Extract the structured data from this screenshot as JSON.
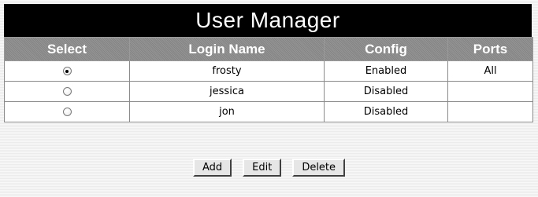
{
  "title": "User Manager",
  "columns": {
    "select": "Select",
    "login": "Login Name",
    "config": "Config",
    "ports": "Ports"
  },
  "rows": [
    {
      "selected": true,
      "login": "frosty",
      "config": "Enabled",
      "ports": "All"
    },
    {
      "selected": false,
      "login": "jessica",
      "config": "Disabled",
      "ports": ""
    },
    {
      "selected": false,
      "login": "jon",
      "config": "Disabled",
      "ports": ""
    }
  ],
  "buttons": {
    "add": "Add",
    "edit": "Edit",
    "delete": "Delete"
  },
  "colors": {
    "title_bg": "#000000",
    "header_bg": "#8c8c8c",
    "page_bg": "#f1f1f1"
  }
}
